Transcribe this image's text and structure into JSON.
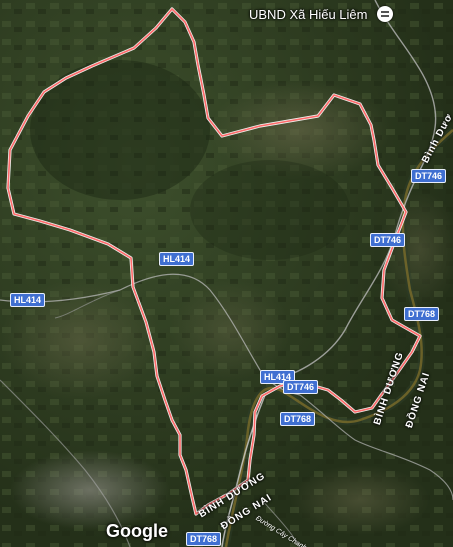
{
  "poi": {
    "label": "UBND Xã Hiếu Liêm",
    "icon": "government-building-icon"
  },
  "road_shields": [
    {
      "id": "hl414-a",
      "label": "HL414"
    },
    {
      "id": "hl414-b",
      "label": "HL414"
    },
    {
      "id": "hl414-c",
      "label": "HL414"
    },
    {
      "id": "dt746-a",
      "label": "DT746"
    },
    {
      "id": "dt746-b",
      "label": "DT746"
    },
    {
      "id": "dt746-c",
      "label": "DT746"
    },
    {
      "id": "dt768-a",
      "label": "DT768"
    },
    {
      "id": "dt768-b",
      "label": "DT768"
    },
    {
      "id": "dt768-c",
      "label": "DT768"
    }
  ],
  "admin_labels": {
    "binh_duong_top": "Bình Dươ",
    "binh_duong_mid": "BÌNH DƯƠNG",
    "dong_nai_mid": "ĐỒNG NAI",
    "binh_duong_bottom": "BÌNH DƯƠNG",
    "dong_nai_bottom": "ĐỒNG NAI"
  },
  "minor_road": "Đường Cây Chanh",
  "logo": "Google",
  "colors": {
    "boundary": "#ff7a7a",
    "river": "#c79a2a",
    "shield": "#3f6fd1",
    "imagery": "#2b3a22"
  }
}
